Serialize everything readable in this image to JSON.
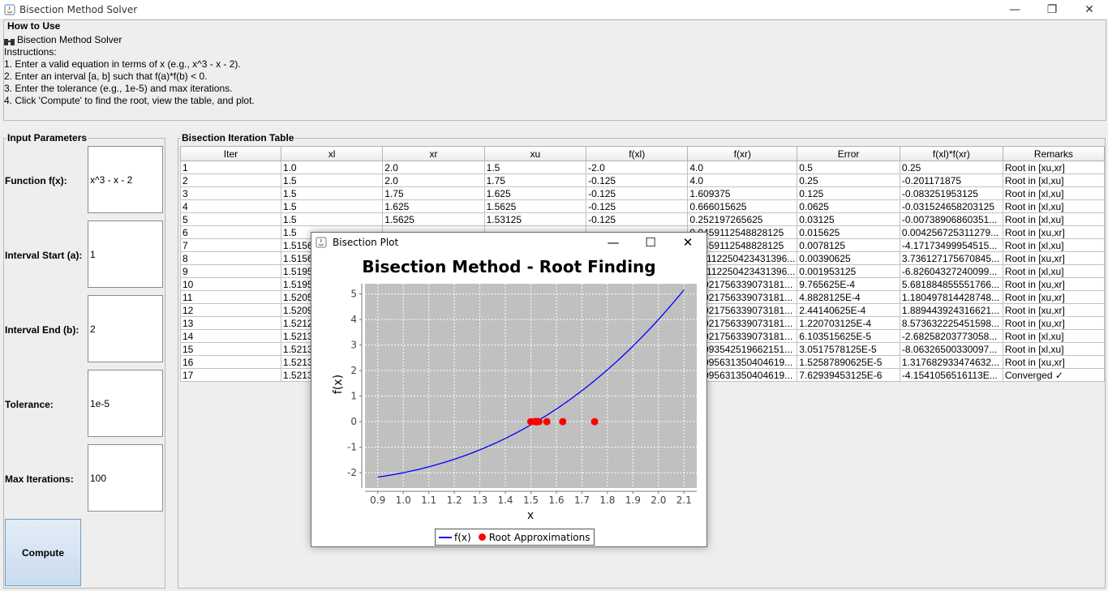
{
  "window": {
    "title": "Bisection Method Solver"
  },
  "how_to_use": {
    "legend": "How to Use",
    "lines": [
      "Bisection Method Solver",
      "Instructions:",
      "1. Enter a valid equation in terms of x (e.g., x^3 - x - 2).",
      "2. Enter an interval [a, b] such that f(a)*f(b) < 0.",
      "3. Enter the tolerance (e.g., 1e-5) and max iterations.",
      "4. Click 'Compute' to find the root, view the table, and plot."
    ]
  },
  "inputs": {
    "legend": "Input Parameters",
    "function_label": "Function f(x):",
    "function_value": "x^3 - x - 2",
    "a_label": "Interval Start (a):",
    "a_value": "1",
    "b_label": "Interval End (b):",
    "b_value": "2",
    "tol_label": "Tolerance:",
    "tol_value": "1e-5",
    "max_label": "Max Iterations:",
    "max_value": "100",
    "compute_label": "Compute"
  },
  "table": {
    "legend": "Bisection Iteration Table",
    "headers": [
      "Iter",
      "xl",
      "xr",
      "xu",
      "f(xl)",
      "f(xr)",
      "Error",
      "f(xl)*f(xr)",
      "Remarks"
    ],
    "rows": [
      [
        "1",
        "1.0",
        "2.0",
        "1.5",
        "-2.0",
        "4.0",
        "0.5",
        "0.25",
        "Root in [xu,xr]"
      ],
      [
        "2",
        "1.5",
        "2.0",
        "1.75",
        "-0.125",
        "4.0",
        "0.25",
        "-0.201171875",
        "Root in [xl,xu]"
      ],
      [
        "3",
        "1.5",
        "1.75",
        "1.625",
        "-0.125",
        "1.609375",
        "0.125",
        "-0.083251953125",
        "Root in [xl,xu]"
      ],
      [
        "4",
        "1.5",
        "1.625",
        "1.5625",
        "-0.125",
        "0.666015625",
        "0.0625",
        "-0.031524658203125",
        "Root in [xl,xu]"
      ],
      [
        "5",
        "1.5",
        "1.5625",
        "1.53125",
        "-0.125",
        "0.252197265625",
        "0.03125",
        "-0.00738906860351...",
        "Root in [xl,xu]"
      ],
      [
        "6",
        "1.5",
        "",
        "",
        "",
        "0.0459112548828125",
        "0.015625",
        "0.004256725311279...",
        "Root in [xu,xr]"
      ],
      [
        "7",
        "1.5156",
        "",
        "",
        "",
        "0.0459112548828125",
        "0.0078125",
        "-4.17173499954515...",
        "Root in [xl,xu]"
      ],
      [
        "8",
        "1.5156",
        "",
        "",
        "",
        "-0.0112250423431396...",
        "0.00390625",
        "3.736127175670845...",
        "Root in [xu,xr]"
      ],
      [
        "9",
        "1.5195",
        "",
        "",
        "",
        "-0.0112250423431396...",
        "0.001953125",
        "-6.82604327240099...",
        "Root in [xl,xu]"
      ],
      [
        "10",
        "1.5195",
        "",
        "",
        "",
        "0.0021756339073181...",
        "9.765625E-4",
        "5.681884855551766...",
        "Root in [xu,xr]"
      ],
      [
        "11",
        "1.5205",
        "",
        "",
        "",
        "0.0021756339073181...",
        "4.8828125E-4",
        "1.180497814428748...",
        "Root in [xu,xr]"
      ],
      [
        "12",
        "1.5209",
        "",
        "",
        "",
        "0.0021756339073181...",
        "2.44140625E-4",
        "1.889443924316621...",
        "Root in [xu,xr]"
      ],
      [
        "13",
        "1.5212",
        "",
        "",
        "",
        "0.0021756339073181...",
        "1.220703125E-4",
        "8.573632225451598...",
        "Root in [xu,xr]"
      ],
      [
        "14",
        "1.5213",
        "",
        "",
        "",
        "0.0021756339073181...",
        "6.103515625E-5",
        "-2.68258203773058...",
        "Root in [xl,xu]"
      ],
      [
        "15",
        "1.5213",
        "",
        "",
        "",
        "0.0093542519662151...",
        "3.0517578125E-5",
        "-8.06326500330097...",
        "Root in [xl,xu]"
      ],
      [
        "16",
        "1.5213",
        "",
        "",
        "",
        "0.0095631350404619...",
        "1.52587890625E-5",
        "1.317682933474632...",
        "Root in [xu,xr]"
      ],
      [
        "17",
        "1.5213",
        "",
        "",
        "",
        "0.0095631350404619...",
        "7.62939453125E-6",
        "-4.1541056516113E...",
        "Converged ✓"
      ]
    ]
  },
  "plot_window": {
    "title": "Bisection Plot",
    "legend_fx": "f(x)",
    "legend_roots": "Root Approximations"
  },
  "chart_data": {
    "type": "line",
    "title": "Bisection Method - Root Finding",
    "xlabel": "x",
    "ylabel": "f(x)",
    "xlim": [
      0.85,
      2.15
    ],
    "ylim": [
      -2.6,
      5.4
    ],
    "xticks": [
      "0.9",
      "1.0",
      "1.1",
      "1.2",
      "1.3",
      "1.4",
      "1.5",
      "1.6",
      "1.7",
      "1.8",
      "1.9",
      "2.0",
      "2.1"
    ],
    "yticks": [
      "5",
      "4",
      "3",
      "2",
      "1",
      "0",
      "-1",
      "-2"
    ],
    "grid": true,
    "legend_position": "bottom",
    "series": [
      {
        "name": "f(x)",
        "function": "x^3 - x - 2",
        "x_range": [
          0.9,
          2.1
        ],
        "color": "#0000ff"
      },
      {
        "name": "Root Approximations",
        "color": "#ff0000",
        "x": [
          1.5,
          1.75,
          1.625,
          1.5625,
          1.53125,
          1.515625,
          1.5234375,
          1.51953125,
          1.521484375,
          1.5205078125,
          1.52099609375,
          1.521240234375,
          1.5213623046875,
          1.52130126953125,
          1.521331787109375,
          1.5213470458984375,
          1.5213394165039062
        ],
        "y": [
          0,
          0,
          0,
          0,
          0,
          0,
          0,
          0,
          0,
          0,
          0,
          0,
          0,
          0,
          0,
          0,
          0
        ]
      }
    ]
  },
  "colors": {
    "curve": "#0000ff",
    "points": "#ff0000",
    "plot_bg": "#c0c0c0"
  }
}
